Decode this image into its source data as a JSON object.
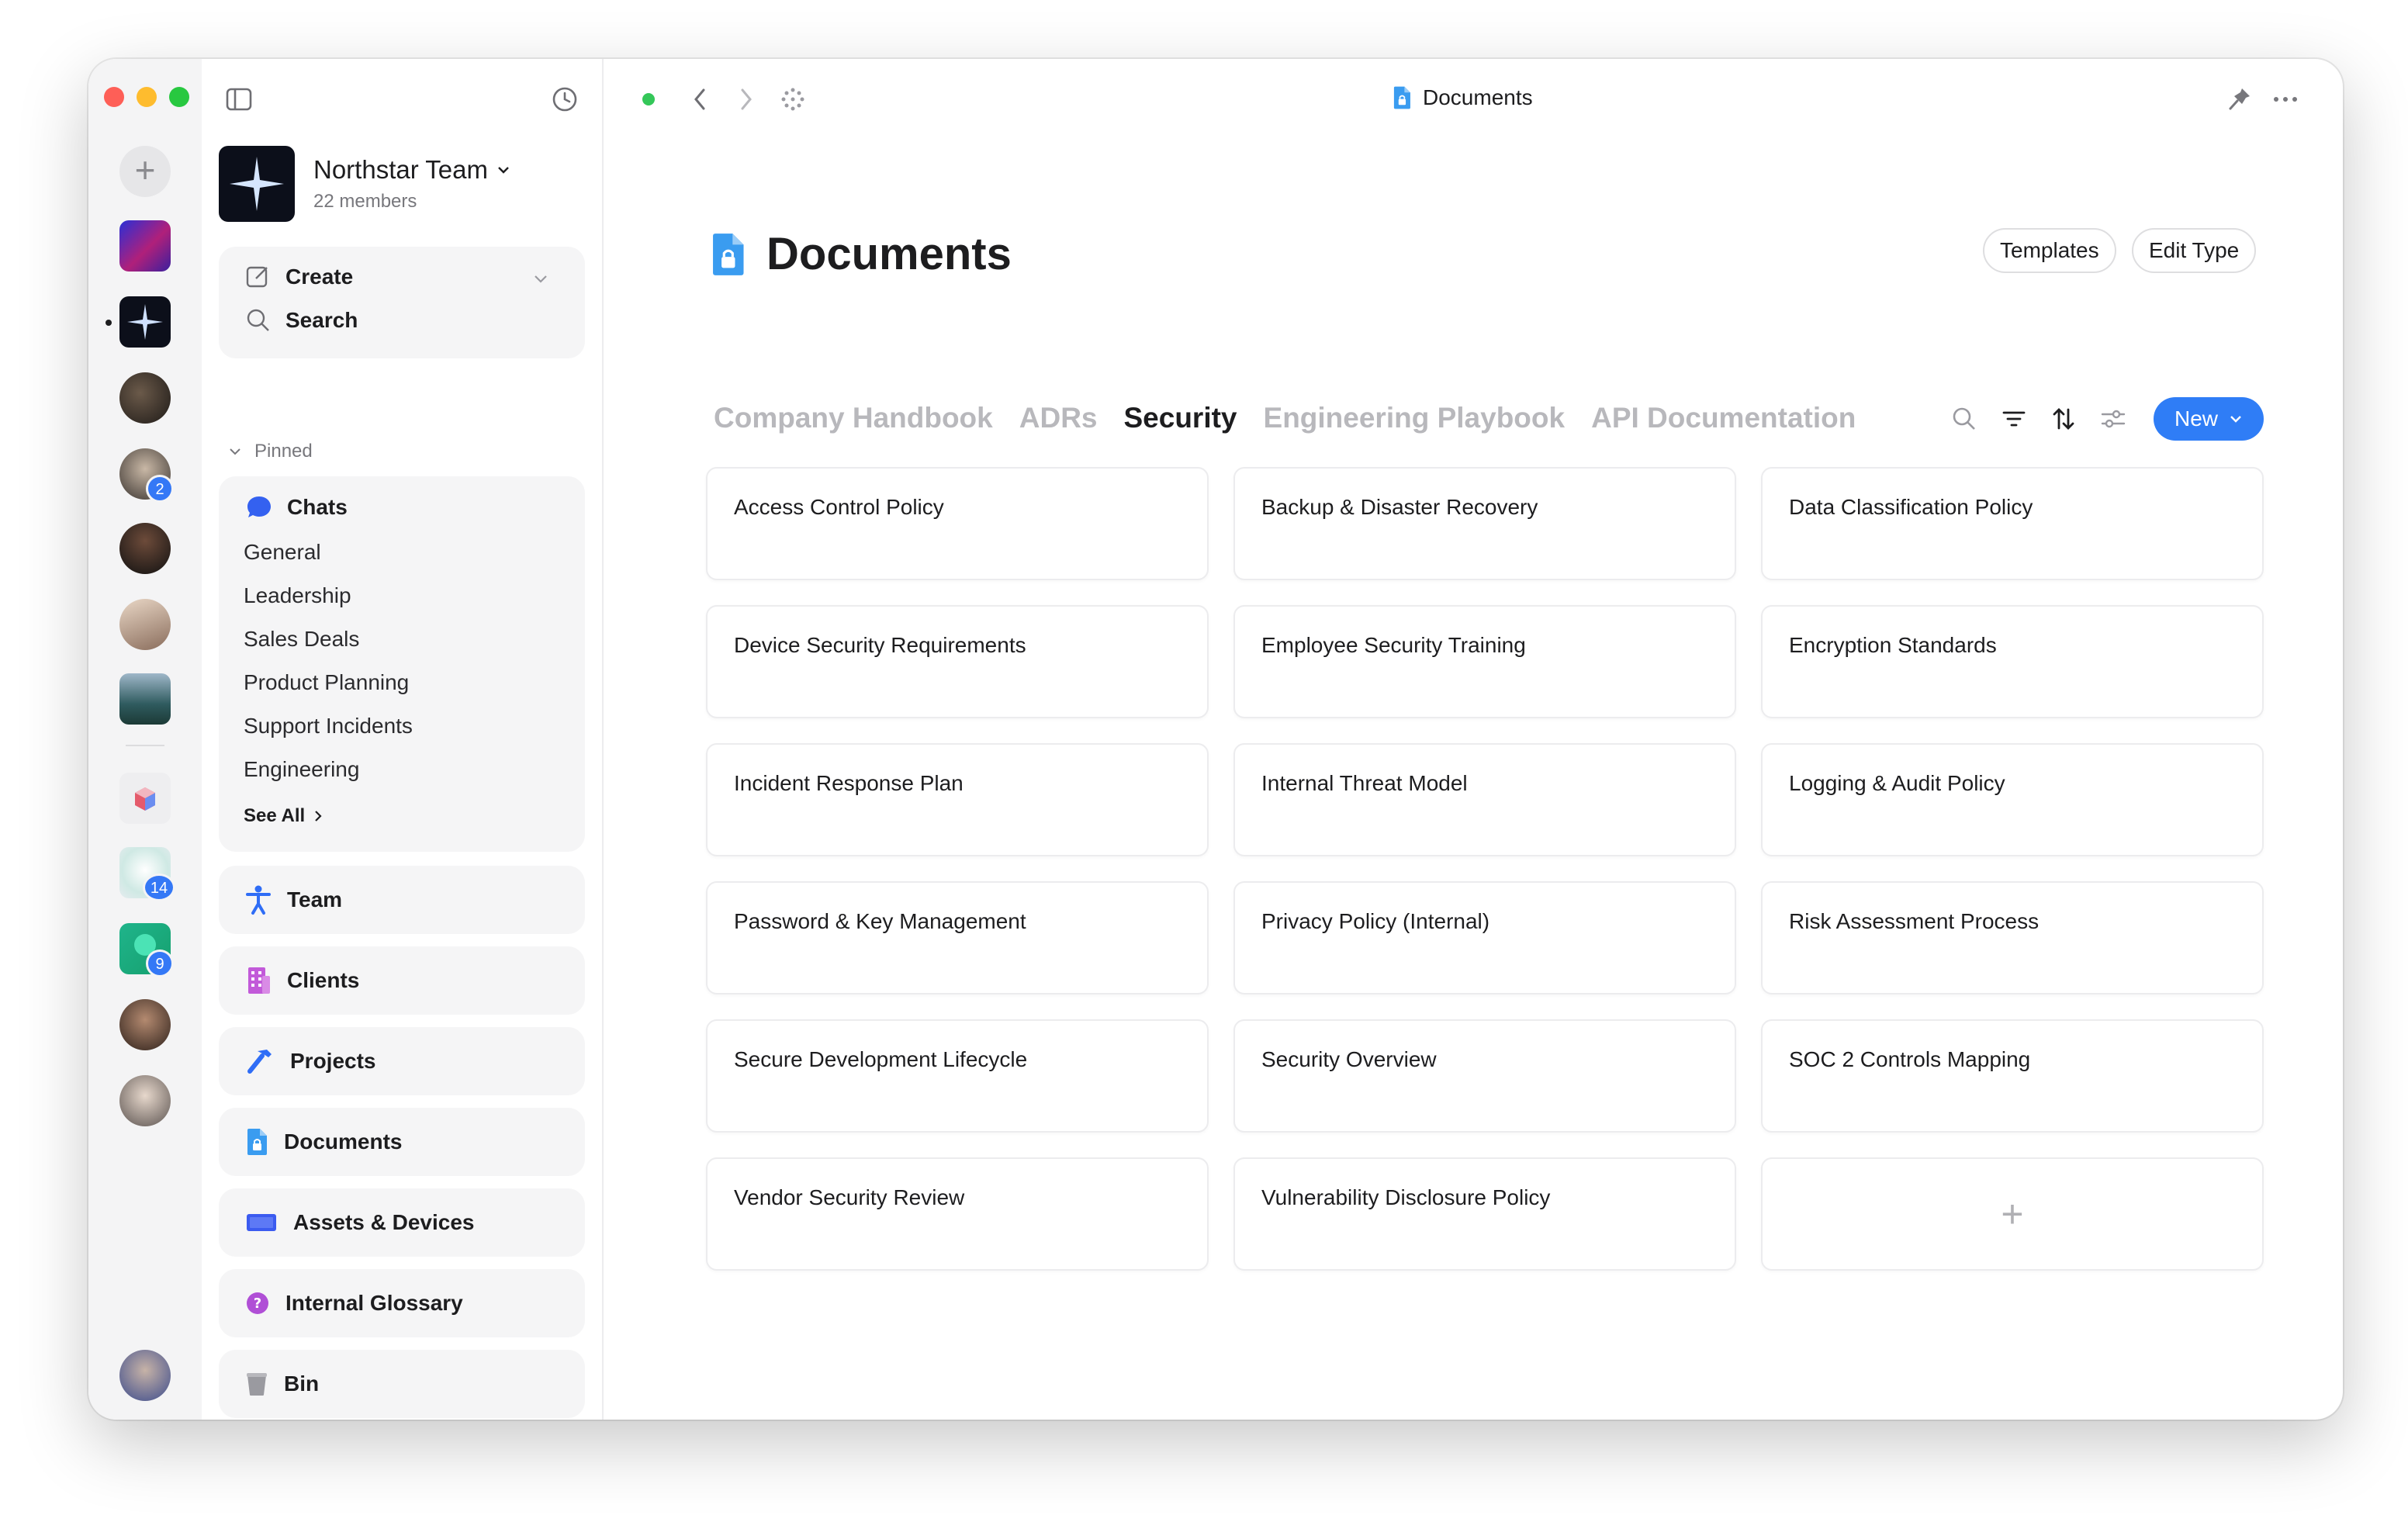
{
  "window": {
    "title": "Documents"
  },
  "rail": {
    "badges": [
      "2",
      "14",
      "9"
    ]
  },
  "sidebar": {
    "team_name": "Northstar Team",
    "team_members": "22 members",
    "create_label": "Create",
    "search_label": "Search",
    "pinned_label": "Pinned",
    "chats_label": "Chats",
    "chats": [
      "General",
      "Leadership",
      "Sales Deals",
      "Product Planning",
      "Support Incidents",
      "Engineering"
    ],
    "see_all": "See All",
    "nav": [
      {
        "label": "Team",
        "icon": "person-icon",
        "color": "#2f6df6"
      },
      {
        "label": "Clients",
        "icon": "building-icon",
        "color": "#c25ad9"
      },
      {
        "label": "Projects",
        "icon": "hammer-icon",
        "color": "#2f6df6"
      },
      {
        "label": "Documents",
        "icon": "document-lock-icon",
        "color": "#3a9cf0"
      },
      {
        "label": "Assets & Devices",
        "icon": "laptop-icon",
        "color": "#3b5bf0"
      },
      {
        "label": "Internal Glossary",
        "icon": "question-icon",
        "color": "#b04fd6"
      },
      {
        "label": "Bin",
        "icon": "bin-icon",
        "color": "#9a9aa0"
      }
    ]
  },
  "main": {
    "title": "Documents",
    "templates_label": "Templates",
    "edit_type_label": "Edit Type",
    "tabs": [
      "Company Handbook",
      "ADRs",
      "Security",
      "Engineering Playbook",
      "API Documentation"
    ],
    "active_tab": "Security",
    "new_label": "New",
    "docs": [
      "Access Control Policy",
      "Backup & Disaster Recovery",
      "Data Classification Policy",
      "Device Security Requirements",
      "Employee Security Training",
      "Encryption Standards",
      "Incident Response Plan",
      "Internal Threat Model",
      "Logging & Audit Policy",
      "Password & Key Management",
      "Privacy Policy (Internal)",
      "Risk Assessment Process",
      "Secure Development Lifecycle",
      "Security Overview",
      "SOC 2 Controls Mapping",
      "Vendor Security Review",
      "Vulnerability Disclosure Policy"
    ],
    "add_symbol": "+"
  },
  "colors": {
    "accent": "#2f7df6",
    "status_dot": "#34c759"
  }
}
